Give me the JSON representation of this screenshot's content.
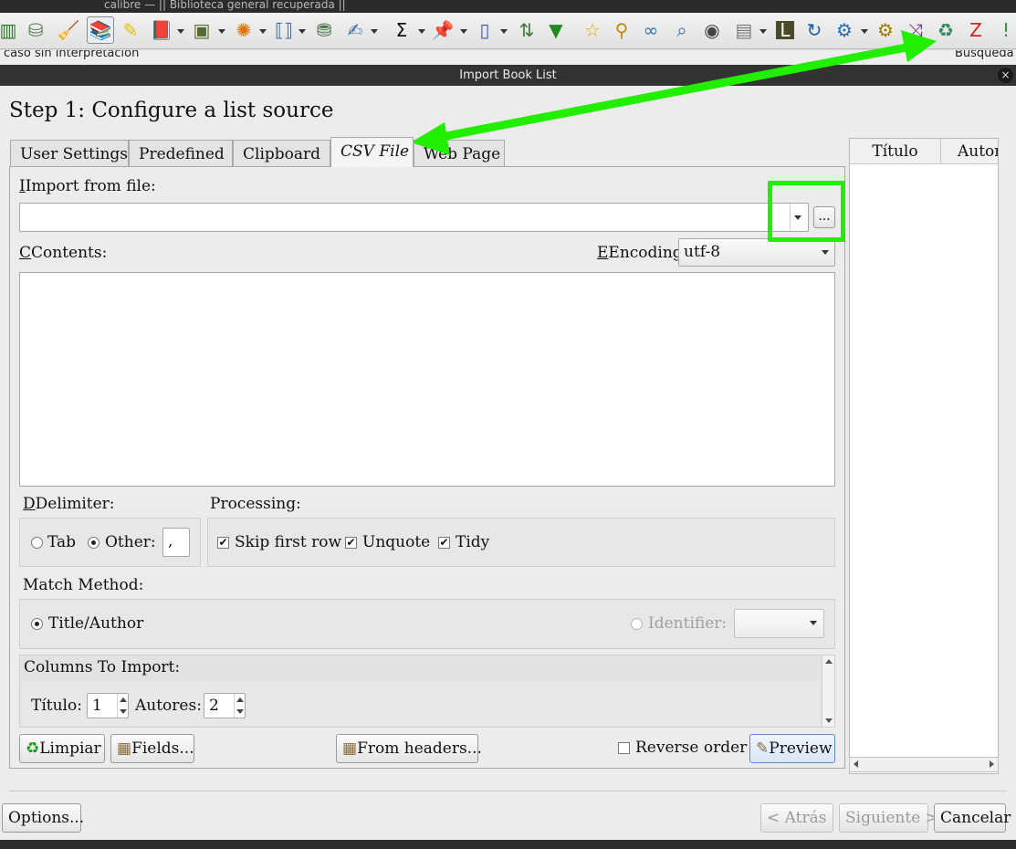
{
  "app": {
    "title": "calibre — || Biblioteca general recuperada ||",
    "search_fragment": "caso sin interpretacion",
    "right_fragment": "Búsqueda",
    "toolbar_icons": [
      "library-icon",
      "check-book-icon",
      "broom-icon",
      "edit-book-icon",
      "highlighter-icon",
      "read-book-icon",
      "send-to-device-icon",
      "news-icon",
      "connect-share-icon",
      "catalog-icon",
      "edit-metadata-icon",
      "sum-icon",
      "pin-icon",
      "column-icon",
      "sort-az-icon",
      "filter-down-icon",
      "star-icon",
      "search-magnify-icon",
      "link-icon",
      "zoom-icon",
      "quality-check-icon",
      "document-icon",
      "calibre-l-icon",
      "refresh-icon",
      "network-icon",
      "gear-icon",
      "shuffle-icon",
      "import-list-icon",
      "z-icon",
      "exclaim-icon"
    ]
  },
  "dialog": {
    "title": "Import Book List",
    "close_label": "×",
    "heading": "Step 1: Configure a list source",
    "tabs": [
      {
        "label": "User Settings"
      },
      {
        "label": "Predefined"
      },
      {
        "label": "Clipboard"
      },
      {
        "label": "CSV File"
      },
      {
        "label": "Web Page"
      }
    ],
    "import_from_file_label": "Import from file:",
    "import_path_value": "",
    "browse_label": "...",
    "contents_label": "Contents:",
    "contents_value": "",
    "encoding_label": "Encoding:",
    "encoding_value": "utf-8",
    "delimiter": {
      "label": "Delimiter:",
      "tab_label": "Tab",
      "other_label": "Other:",
      "other_value": ","
    },
    "processing": {
      "label": "Processing:",
      "skip_first_row": "Skip first row",
      "unquote": "Unquote",
      "tidy": "Tidy",
      "check_mark": "✔"
    },
    "match_method": {
      "label": "Match Method:",
      "title_author": "Title/Author",
      "identifier": "Identifier:",
      "identifier_value": ""
    },
    "columns": {
      "label": "Columns To Import:",
      "titulo_label": "Título:",
      "titulo_value": "1",
      "autores_label": "Autores:",
      "autores_value": "2"
    },
    "buttons": {
      "limpiar": "Limpiar",
      "fields": "Fields...",
      "from_headers": "From headers...",
      "reverse_order": "Reverse order",
      "preview": "Preview",
      "options": "Options...",
      "atras": "< Atrás",
      "siguiente": "Siguiente >",
      "cancelar": "Cancelar"
    },
    "table": {
      "headers": [
        "Título",
        "Autor"
      ]
    }
  },
  "colors": {
    "annotation_green": "#22ee00",
    "title_bar": "#333333",
    "dialog_bg": "#ececec"
  }
}
